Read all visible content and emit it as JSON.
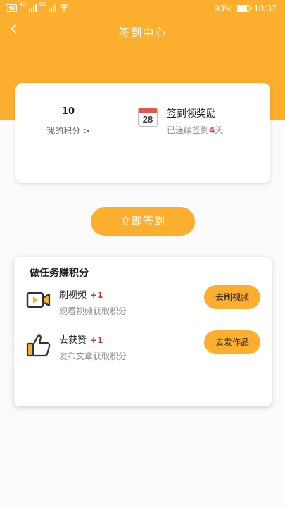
{
  "status_bar": {
    "hd_label": "HD",
    "network_1": "4G",
    "network_2": "2G",
    "battery_percent": "93%",
    "battery_level": 0.93,
    "time": "10:37"
  },
  "header": {
    "title": "签到中心",
    "back_icon": "chevron-left-icon"
  },
  "summary": {
    "points_value": "10",
    "points_label": "我的积分 >",
    "calendar_day": "28",
    "checkin_title": "签到领奖励",
    "checkin_sub_prefix": "已连续签到",
    "checkin_days": "4",
    "checkin_sub_suffix": "天"
  },
  "checkin_button": "立即签到",
  "tasks": {
    "title": "做任务赚积分",
    "items": [
      {
        "icon": "video-camera-icon",
        "name": "刷视频",
        "bonus": "+1",
        "desc": "观看视频获取积分",
        "button": "去刷视频"
      },
      {
        "icon": "thumbs-up-icon",
        "name": "去获赞",
        "bonus": "+1",
        "desc": "发布文章获取积分",
        "button": "去发作品"
      }
    ]
  },
  "colors": {
    "accent": "#fcae2e",
    "highlight": "#e0443a"
  }
}
